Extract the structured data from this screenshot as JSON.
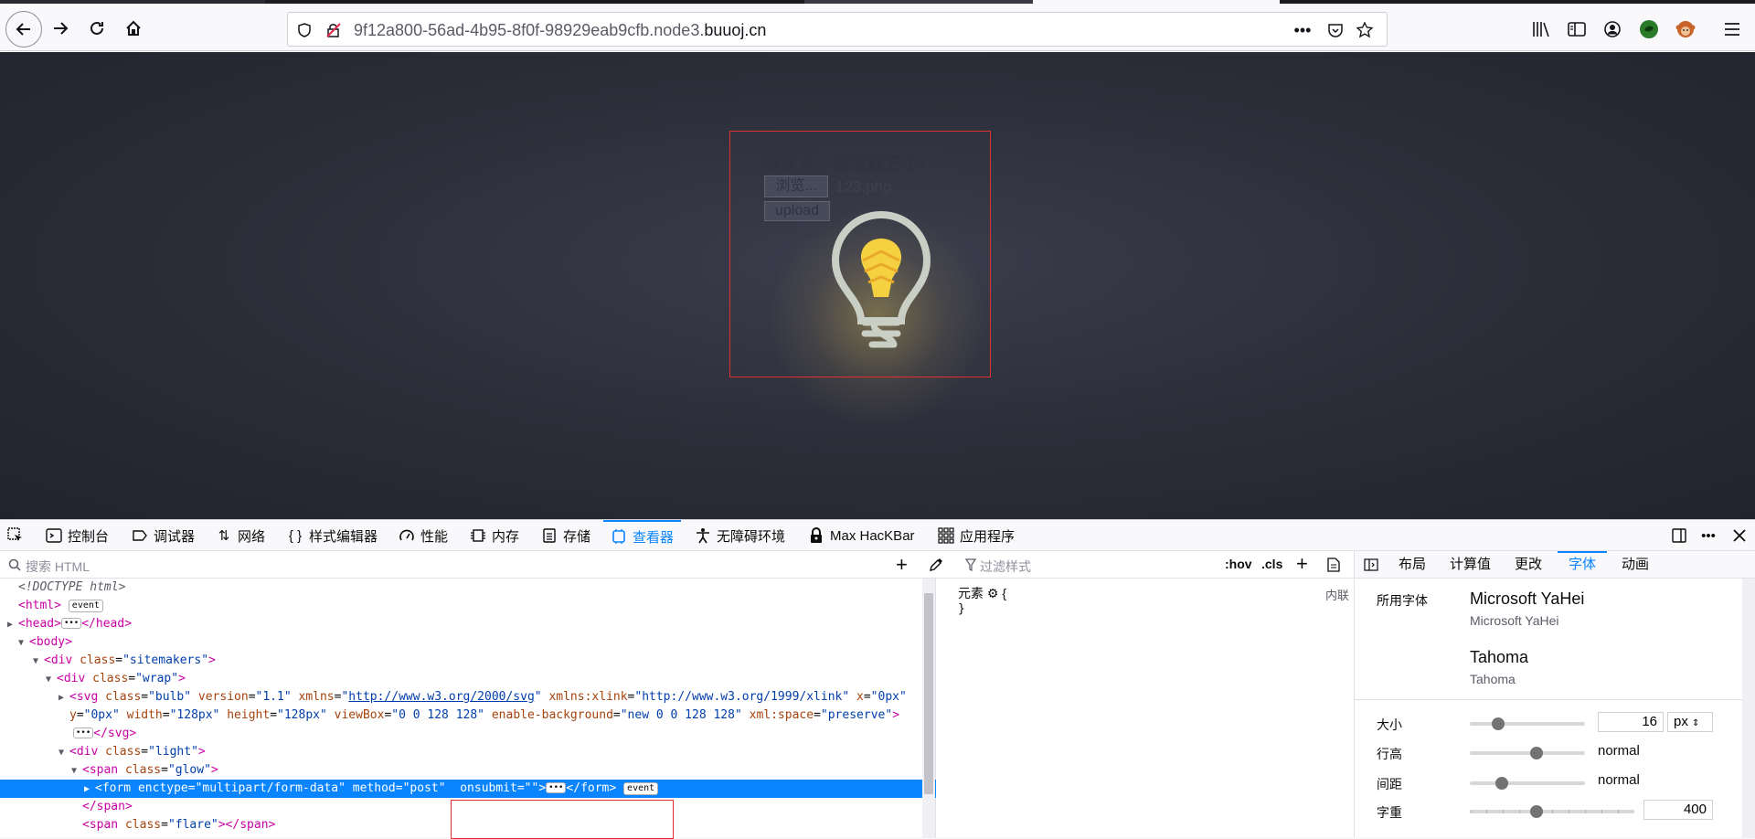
{
  "browser": {
    "url_prefix": "9f12a800-56ad-4b95-8f0f-98929eab9cfb.node3.",
    "url_domain": "buuoj.cn"
  },
  "page": {
    "hint_text": "嘻伙计，你发现它了!",
    "browse_label": "浏览...",
    "file_name": "123.php",
    "upload_label": "upload"
  },
  "devtools": {
    "tabs": [
      {
        "label": "控制台",
        "icon": "console-icon"
      },
      {
        "label": "调试器",
        "icon": "debugger-icon"
      },
      {
        "label": "网络",
        "icon": "network-icon"
      },
      {
        "label": "样式编辑器",
        "icon": "style-editor-icon"
      },
      {
        "label": "性能",
        "icon": "performance-icon"
      },
      {
        "label": "内存",
        "icon": "memory-icon"
      },
      {
        "label": "存储",
        "icon": "storage-icon"
      },
      {
        "label": "查看器",
        "icon": "inspector-icon"
      },
      {
        "label": "无障碍环境",
        "icon": "accessibility-icon"
      },
      {
        "label": "Max HacKBar",
        "icon": "hackbar-icon"
      },
      {
        "label": "应用程序",
        "icon": "application-icon"
      }
    ],
    "active_tab": "查看器",
    "search_placeholder": "搜索 HTML",
    "markup": {
      "doctype": "<!DOCTYPE html>",
      "event_badge": "event",
      "url_svg_ns": "http://www.w3.org/2000/svg",
      "url_xlink_ns": "http://www.w3.org/1999/xlink"
    },
    "rules": {
      "filter_placeholder": "过滤样式",
      "hov": ":hov",
      "cls": ".cls",
      "element_label": "元素",
      "inline_label": "内联"
    },
    "fonts_panel": {
      "subtabs": [
        "布局",
        "计算值",
        "更改",
        "字体",
        "动画"
      ],
      "active_subtab": "字体",
      "used_fonts_label": "所用字体",
      "fonts": [
        {
          "name": "Microsoft YaHei",
          "source": "Microsoft YaHei"
        },
        {
          "name": "Tahoma",
          "source": "Tahoma"
        }
      ],
      "size_label": "大小",
      "size_value": "16",
      "size_unit": "px",
      "line_height_label": "行高",
      "line_height_value": "normal",
      "spacing_label": "间距",
      "spacing_value": "normal",
      "weight_label": "字重",
      "weight_value": "400"
    }
  },
  "colors": {
    "accent": "#0a84ff",
    "highlight_border": "#e03030",
    "bulb_yellow": "#f5d142"
  }
}
